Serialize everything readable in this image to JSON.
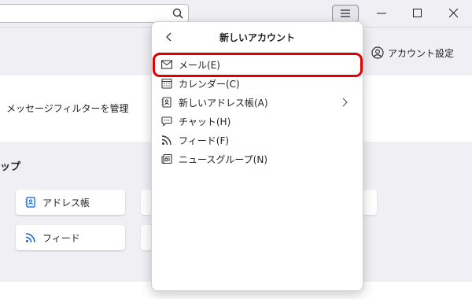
{
  "popup": {
    "title": "新しいアカウント",
    "items": [
      {
        "label": "メール(E)",
        "icon": "mail-icon"
      },
      {
        "label": "カレンダー(C)",
        "icon": "calendar-icon"
      },
      {
        "label": "新しいアドレス帳(A)",
        "icon": "address-book-icon",
        "has_submenu": true
      },
      {
        "label": "チャット(H)",
        "icon": "chat-icon"
      },
      {
        "label": "フィード(F)",
        "icon": "feed-icon"
      },
      {
        "label": "ニュースグループ(N)",
        "icon": "newsgroup-icon"
      }
    ]
  },
  "header": {
    "account_settings_label": "アカウント設定"
  },
  "content": {
    "manage_filters_label": "メッセージフィルターを管理",
    "section_title_fragment": "ップ",
    "cards": [
      {
        "label": "アドレス帳",
        "icon": "address-book-icon"
      },
      {
        "label": "フィード",
        "icon": "feed-icon"
      }
    ]
  },
  "colors": {
    "accent": "#0060df",
    "highlight": "#e00000",
    "background": "#f0f0f4"
  }
}
